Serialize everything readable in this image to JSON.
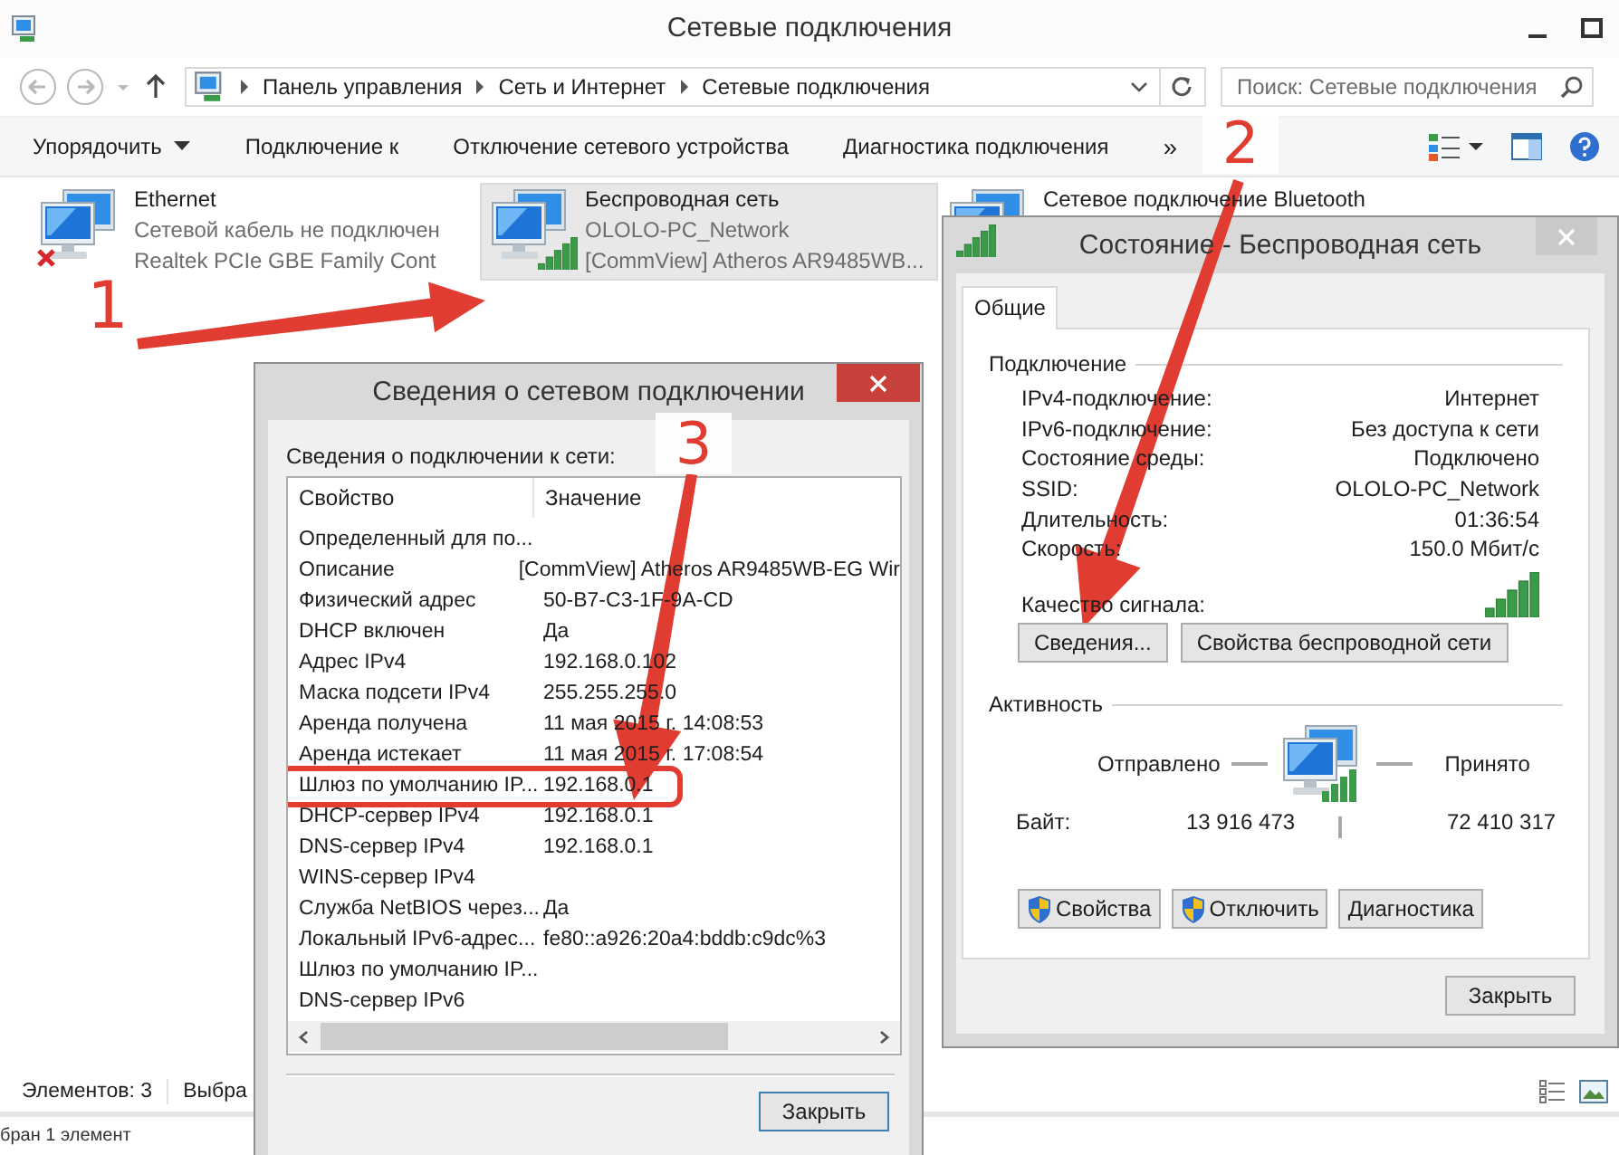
{
  "window": {
    "title": "Сетевые подключения"
  },
  "address_bar": {
    "crumbs": [
      "Панель управления",
      "Сеть и Интернет",
      "Сетевые подключения"
    ]
  },
  "search": {
    "placeholder": "Поиск: Сетевые подключения"
  },
  "toolbar": {
    "items": [
      {
        "label": "Упорядочить",
        "kind": "menu"
      },
      {
        "label": "Подключение к",
        "kind": "plain"
      },
      {
        "label": "Отключение сетевого устройства",
        "kind": "plain"
      },
      {
        "label": "Диагностика подключения",
        "kind": "plain"
      }
    ],
    "overflow": "»"
  },
  "connections": [
    {
      "name": "Ethernet",
      "status": "Сетевой кабель не подключен",
      "adapter": "Realtek PCIe GBE Family Cont",
      "kind": "wired",
      "disconnected": true,
      "selected": false
    },
    {
      "name": "Беспроводная сеть",
      "status": "OLOLO-PC_Network",
      "adapter": "[CommView] Atheros AR9485WB...",
      "kind": "wireless",
      "disconnected": false,
      "selected": true
    },
    {
      "name": "Сетевое подключение Bluetooth",
      "kind": "bluetooth",
      "disconnected": false,
      "selected": false
    }
  ],
  "status_bar": {
    "count": "Элементов: 3",
    "selection": "Выбра"
  },
  "background_window": {
    "status": "бран 1 элемент"
  },
  "details_dialog": {
    "title": "Сведения о сетевом подключении",
    "caption": "Сведения о подключении к сети:",
    "columns": [
      "Свойство",
      "Значение"
    ],
    "rows": [
      {
        "property": "Определенный для по...",
        "highlighted": false
      },
      {
        "property": "Описание",
        "value": "[CommView] Atheros AR9485WB-EG Wir",
        "highlighted": false
      },
      {
        "property": "Физический адрес",
        "value": "50-B7-C3-1F-9A-CD",
        "highlighted": false
      },
      {
        "property": "DHCP включен",
        "value": "Да",
        "highlighted": false
      },
      {
        "property": "Адрес IPv4",
        "value": "192.168.0.102",
        "highlighted": false
      },
      {
        "property": "Маска подсети IPv4",
        "value": "255.255.255.0",
        "highlighted": false
      },
      {
        "property": "Аренда получена",
        "value": "11 мая 2015 г. 14:08:53",
        "highlighted": false
      },
      {
        "property": "Аренда истекает",
        "value": "11 мая 2015 г. 17:08:54",
        "highlighted": false
      },
      {
        "property": "Шлюз по умолчанию IP...",
        "value": "192.168.0.1",
        "highlighted": true
      },
      {
        "property": "DHCP-сервер IPv4",
        "value": "192.168.0.1",
        "highlighted": false
      },
      {
        "property": "DNS-сервер IPv4",
        "value": "192.168.0.1",
        "highlighted": false
      },
      {
        "property": "WINS-сервер IPv4",
        "highlighted": false
      },
      {
        "property": "Служба NetBIOS через...",
        "value": "Да",
        "highlighted": false
      },
      {
        "property": "Локальный IPv6-адрес...",
        "value": "fe80::a926:20a4:bddb:c9dc%3",
        "highlighted": false
      },
      {
        "property": "Шлюз по умолчанию IP...",
        "highlighted": false
      },
      {
        "property": "DNS-сервер IPv6",
        "highlighted": false
      }
    ],
    "close_button": "Закрыть"
  },
  "status_dialog": {
    "title": "Состояние - Беспроводная сеть",
    "tabs": [
      {
        "label": "Общие",
        "selected": true
      }
    ],
    "connection": {
      "heading": "Подключение",
      "rows": [
        {
          "label": "IPv4-подключение:",
          "value": "Интернет"
        },
        {
          "label": "IPv6-подключение:",
          "value": "Без доступа к сети"
        },
        {
          "label": "Состояние среды:",
          "value": "Подключено"
        },
        {
          "label": "SSID:",
          "value": "OLOLO-PC_Network"
        },
        {
          "label": "Длительность:",
          "value": "01:36:54"
        },
        {
          "label": "Скорость:",
          "value": "150.0 Мбит/с"
        }
      ],
      "signal_label": "Качество сигнала:"
    },
    "buttons": [
      "Сведения...",
      "Свойства беспроводной сети"
    ],
    "activity": {
      "heading": "Активность",
      "sent_label": "Отправлено",
      "received_label": "Принято",
      "bytes_label": "Байт:",
      "sent": "13 916 473",
      "received": "72 410 317"
    },
    "action_buttons": [
      {
        "label": "Свойства",
        "kind": "shield"
      },
      {
        "label": "Отключить",
        "kind": "shield"
      },
      {
        "label": "Диагностика",
        "kind": "plain"
      }
    ],
    "close_button": "Закрыть"
  },
  "annotations": [
    {
      "label": "1",
      "kind": "plain"
    },
    {
      "label": "2",
      "kind": "badge"
    },
    {
      "label": "3",
      "kind": "badge"
    }
  ]
}
